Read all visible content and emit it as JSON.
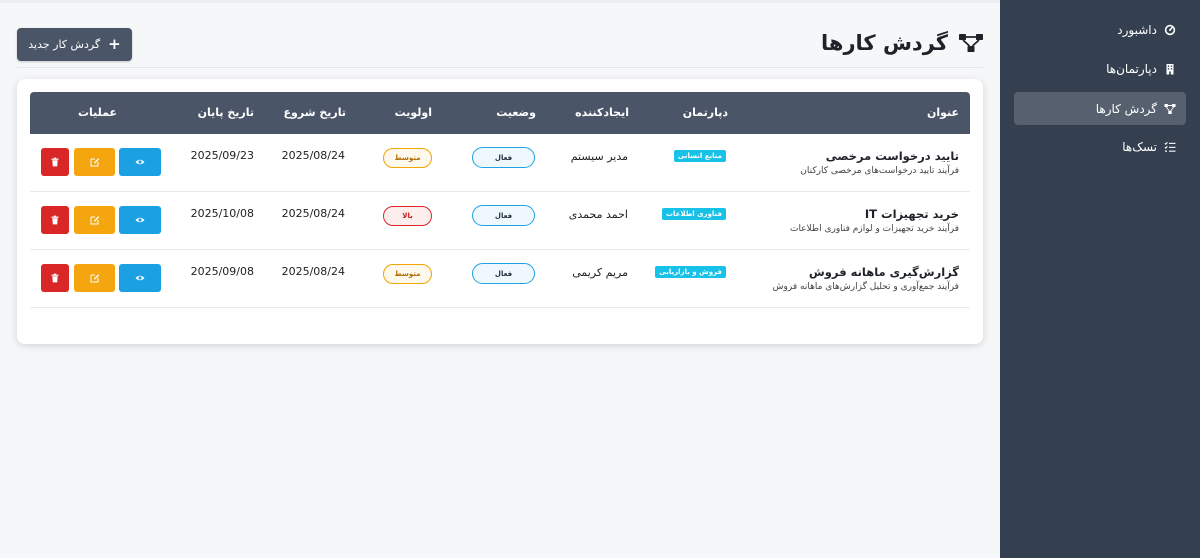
{
  "sidebar": {
    "items": [
      {
        "label": "داشبورد",
        "icon": "dashboard-gauge-icon",
        "active": false
      },
      {
        "label": "دپارتمان‌ها",
        "icon": "building-icon",
        "active": false
      },
      {
        "label": "گردش کارها",
        "icon": "workflow-icon",
        "active": true
      },
      {
        "label": "تسک‌ها",
        "icon": "tasks-list-icon",
        "active": false
      }
    ]
  },
  "header": {
    "title": "گردش کارها",
    "title_icon": "workflow-icon",
    "new_button_label": "گردش کار جدید",
    "new_button_icon": "plus-icon"
  },
  "table": {
    "columns": {
      "title": "عنوان",
      "department": "دپارتمان",
      "creator": "ایجادکننده",
      "status": "وضعیت",
      "priority": "اولویت",
      "start_date": "تاریخ شروع",
      "end_date": "تاریخ پایان",
      "actions": "عملیات"
    },
    "rows": [
      {
        "title": "تایید درخواست مرخصی",
        "description": "فرآیند تایید درخواست‌های مرخصی کارکنان",
        "department": "منابع انسانی",
        "creator": "مدیر سیستم",
        "status": "فعال",
        "priority": "متوسط",
        "priority_level": "medium",
        "start_date": "2025/08/24",
        "end_date": "2025/09/23"
      },
      {
        "title": "خرید تجهیزات IT",
        "description": "فرآیند خرید تجهیزات و لوازم فناوری اطلاعات",
        "department": "فناوری اطلاعات",
        "creator": "احمد محمدی",
        "status": "فعال",
        "priority": "بالا",
        "priority_level": "high",
        "start_date": "2025/08/24",
        "end_date": "2025/10/08"
      },
      {
        "title": "گزارش‌گیری ماهانه فروش",
        "description": "فرآیند جمع‌آوری و تحلیل گزارش‌های ماهانه فروش",
        "department": "فروش و بازاریابی",
        "creator": "مریم کریمی",
        "status": "فعال",
        "priority": "متوسط",
        "priority_level": "medium",
        "start_date": "2025/08/24",
        "end_date": "2025/09/08"
      }
    ],
    "action_icons": [
      "eye-icon",
      "edit-icon",
      "trash-icon"
    ]
  },
  "colors": {
    "sidebar_bg": "#343f4f",
    "sidebar_active": "#56606f",
    "table_header_bg": "#4a5568",
    "view_button": "#1ba0e2",
    "edit_button": "#f5a50e",
    "delete_button": "#d92626",
    "department_badge": "#17c1e8",
    "status_border": "#1ea3e3",
    "priority_medium": "#f0a500",
    "priority_high": "#e02424"
  }
}
